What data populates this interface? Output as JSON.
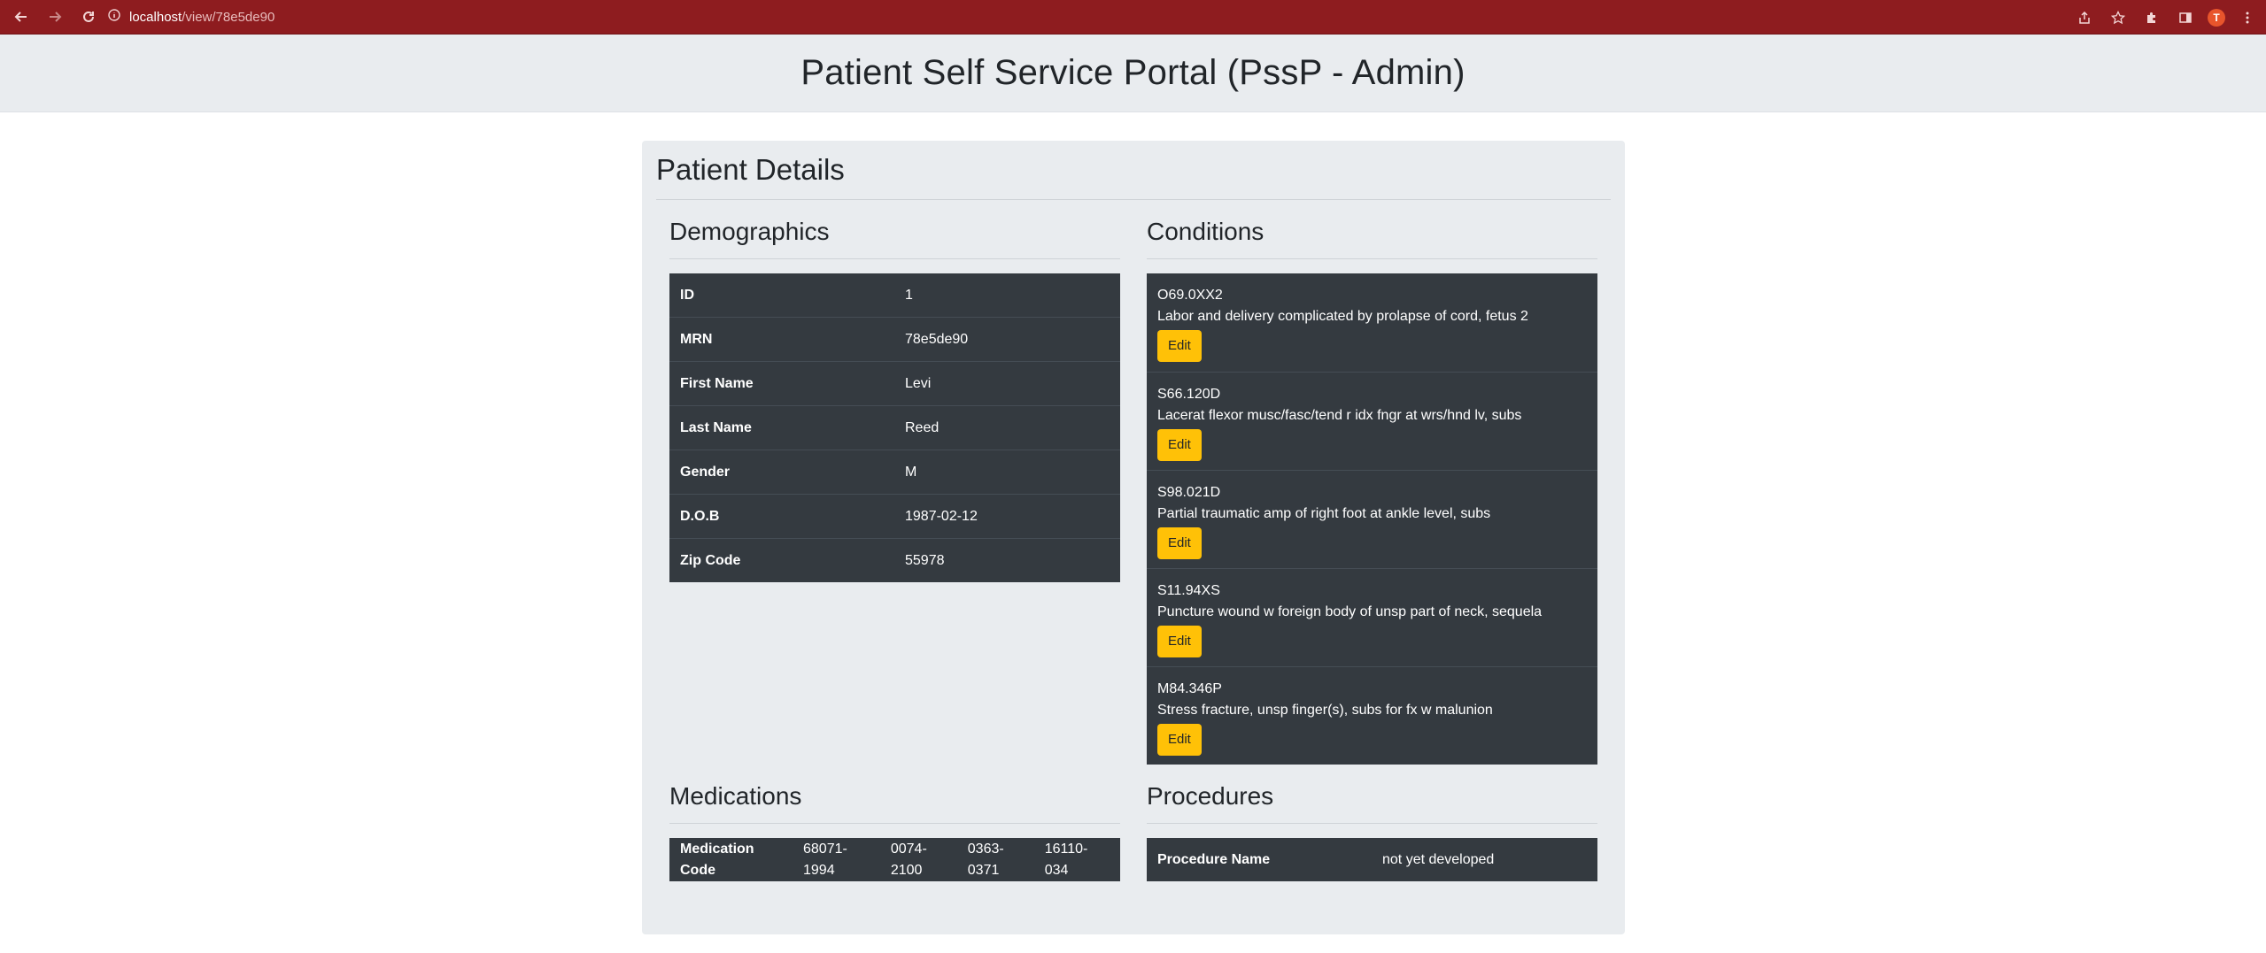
{
  "browser": {
    "url_host": "localhost",
    "url_path": "/view/78e5de90",
    "avatar_letter": "T"
  },
  "header": {
    "title": "Patient Self Service Portal (PssP - Admin)"
  },
  "card": {
    "title": "Patient Details"
  },
  "demographics": {
    "title": "Demographics",
    "rows": [
      {
        "label": "ID",
        "value": "1"
      },
      {
        "label": "MRN",
        "value": "78e5de90"
      },
      {
        "label": "First Name",
        "value": "Levi"
      },
      {
        "label": "Last Name",
        "value": "Reed"
      },
      {
        "label": "Gender",
        "value": "M"
      },
      {
        "label": "D.O.B",
        "value": "1987-02-12"
      },
      {
        "label": "Zip Code",
        "value": "55978"
      }
    ]
  },
  "conditions": {
    "title": "Conditions",
    "edit_label": "Edit",
    "items": [
      {
        "code": "O69.0XX2",
        "description": "Labor and delivery complicated by prolapse of cord, fetus 2"
      },
      {
        "code": "S66.120D",
        "description": "Lacerat flexor musc/fasc/tend r idx fngr at wrs/hnd lv, subs"
      },
      {
        "code": "S98.021D",
        "description": "Partial traumatic amp of right foot at ankle level, subs"
      },
      {
        "code": "S11.94XS",
        "description": "Puncture wound w foreign body of unsp part of neck, sequela"
      },
      {
        "code": "M84.346P",
        "description": "Stress fracture, unsp finger(s), subs for fx w malunion"
      }
    ]
  },
  "medications": {
    "title": "Medications",
    "label_line1": "Medication",
    "label_line2": "Code",
    "codes": [
      {
        "line1": "68071-",
        "line2": "1994"
      },
      {
        "line1": "0074-",
        "line2": "2100"
      },
      {
        "line1": "0363-",
        "line2": "0371"
      },
      {
        "line1": "16110-",
        "line2": "034"
      }
    ]
  },
  "procedures": {
    "title": "Procedures",
    "label": "Procedure Name",
    "value": "not yet developed"
  },
  "colors": {
    "chrome": "#8e1c1f",
    "header_bg": "#e9ecef",
    "table_dark": "#343a40",
    "edit_button": "#ffc107"
  }
}
